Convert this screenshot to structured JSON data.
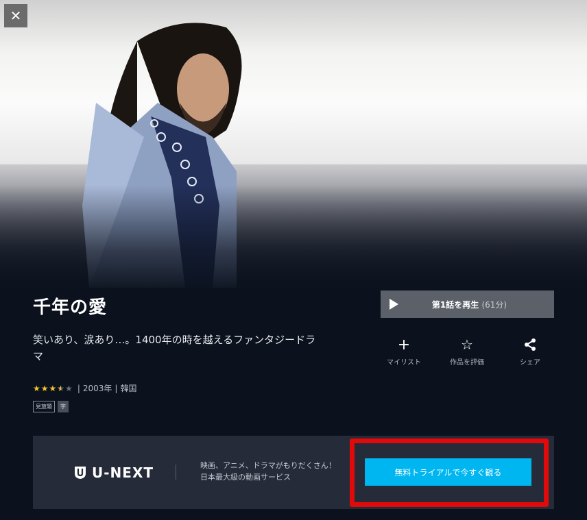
{
  "close": {
    "glyph": "✕"
  },
  "title": "千年の愛",
  "synopsis": "笑いあり、涙あり…。1400年の時を越えるファンタジードラマ",
  "rating": {
    "value": 3.5,
    "max": 5,
    "stars_filled": "★★★",
    "star_half": "★",
    "star_empty": "★"
  },
  "meta": {
    "year": "2003年",
    "country": "韓国",
    "separator": "|"
  },
  "tags": [
    "見放題",
    "字"
  ],
  "play": {
    "label": "第1話を再生",
    "duration": "(61分)"
  },
  "actions": [
    {
      "icon": "plus-icon",
      "glyph": "+",
      "label": "マイリスト"
    },
    {
      "icon": "star-outline-icon",
      "glyph": "☆",
      "label": "作品を評価"
    },
    {
      "icon": "share-icon",
      "glyph": "",
      "label": "シェア"
    }
  ],
  "promo": {
    "brand": "U-NEXT",
    "copy_line1": "映画、アニメ、ドラマがもりだくさん！",
    "copy_line2": "日本最大級の動画サービス",
    "cta": "無料トライアルで今すぐ観る",
    "highlight_color": "#e00a0a",
    "cta_color": "#00b6f0"
  }
}
